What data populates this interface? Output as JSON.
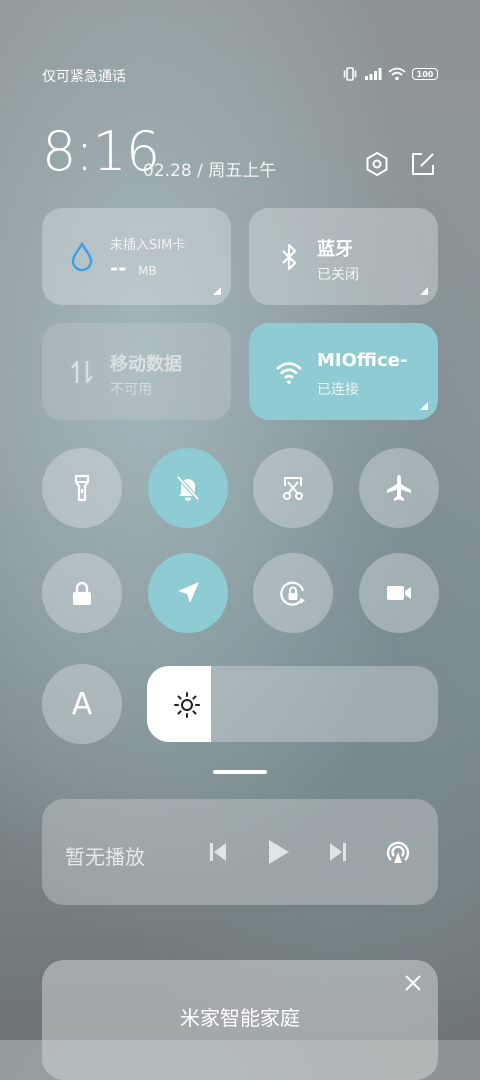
{
  "status_bar": {
    "carrier": "仅可紧急通话",
    "battery": "100",
    "icons": [
      "vibrate-icon",
      "signal-icon",
      "wifi-icon",
      "battery-icon"
    ]
  },
  "header": {
    "time": "8:16",
    "date": "02.28 / 周五上午",
    "icons": [
      "settings-icon",
      "edit-icon"
    ]
  },
  "tiles": {
    "data_usage": {
      "title": "未插入SIM卡",
      "value": "--",
      "unit": "MB",
      "icon": "water-drop-icon"
    },
    "bluetooth": {
      "title": "蓝牙",
      "status": "已关闭",
      "icon": "bluetooth-icon"
    },
    "mobile_data": {
      "title": "移动数据",
      "status": "不可用",
      "icon": "mobile-data-icon"
    },
    "wifi": {
      "title": "MIOffice-",
      "status": "已连接",
      "icon": "wifi-icon",
      "active": true
    }
  },
  "toggles": [
    {
      "name": "flashlight",
      "icon": "flashlight-icon",
      "active": false
    },
    {
      "name": "mute",
      "icon": "bell-off-icon",
      "active": true
    },
    {
      "name": "screenshot",
      "icon": "screenshot-icon",
      "active": false
    },
    {
      "name": "airplane",
      "icon": "airplane-icon",
      "active": false
    },
    {
      "name": "lock-screen",
      "icon": "lock-icon",
      "active": false
    },
    {
      "name": "location",
      "icon": "location-icon",
      "active": true
    },
    {
      "name": "rotation-lock",
      "icon": "rotation-lock-icon",
      "active": false
    },
    {
      "name": "screen-record",
      "icon": "video-camera-icon",
      "active": false
    }
  ],
  "auto_brightness": {
    "label": "A"
  },
  "brightness": {
    "level": 0.22,
    "icon": "sun-icon"
  },
  "media": {
    "label": "暂无播放",
    "icons": [
      "previous-icon",
      "play-icon",
      "next-icon",
      "cast-icon"
    ]
  },
  "smart_home": {
    "title": "米家智能家庭",
    "icon": "close-icon"
  },
  "colors": {
    "accent": "#8fcbd2",
    "tile": "rgba(225,232,234,0.38)"
  }
}
